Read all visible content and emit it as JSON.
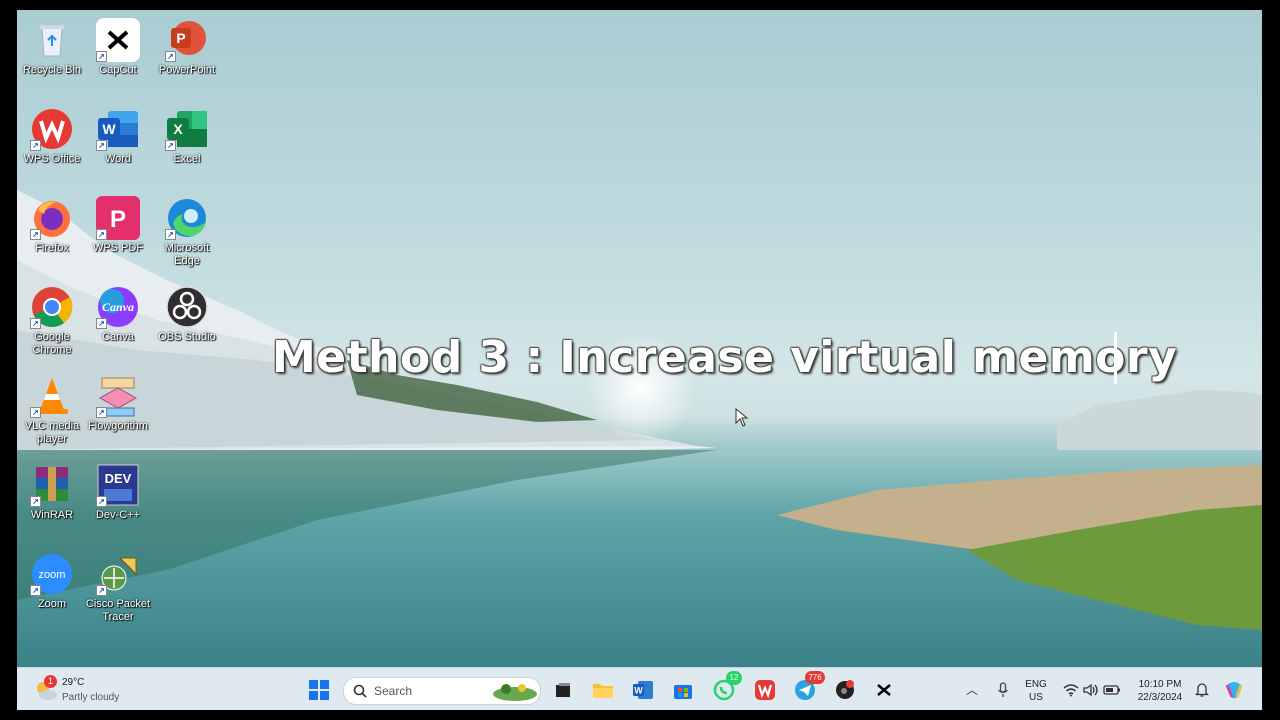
{
  "overlay": {
    "title": "Method 3 : Increase virtual memory"
  },
  "desktop": {
    "icons": [
      {
        "label": "Recycle Bin"
      },
      {
        "label": "CapCut"
      },
      {
        "label": "PowerPoint"
      },
      {
        "label": "WPS Office"
      },
      {
        "label": "Word"
      },
      {
        "label": "Excel"
      },
      {
        "label": "Firefox"
      },
      {
        "label": "WPS PDF"
      },
      {
        "label": "Microsoft Edge"
      },
      {
        "label": "Google Chrome"
      },
      {
        "label": "Canva"
      },
      {
        "label": "OBS Studio"
      },
      {
        "label": "VLC media player"
      },
      {
        "label": "Flowgorithm"
      },
      {
        "label": "WinRAR"
      },
      {
        "label": "Dev-C++"
      },
      {
        "label": "Zoom"
      },
      {
        "label": "Cisco Packet Tracer"
      }
    ],
    "icon_glyphs": {
      "powerpoint": "P",
      "word": "W",
      "excel": "X",
      "wps_pdf": "P",
      "canva": "Canva",
      "dev": "DEV",
      "zoom": "zoom"
    }
  },
  "taskbar": {
    "weather": {
      "temp": "29°C",
      "condition": "Partly cloudy",
      "badge": "1"
    },
    "search_placeholder": "Search",
    "badges": {
      "whatsapp": "12",
      "telegram": "776"
    },
    "language": {
      "line1": "ENG",
      "line2": "US"
    },
    "clock": {
      "time": "10:10 PM",
      "date": "22/3/2024"
    }
  },
  "colors": {
    "taskbar_bg": "#dfe9f0",
    "accent_blue": "#1a73e8",
    "badge_green": "#25d366",
    "badge_red": "#e53935"
  }
}
